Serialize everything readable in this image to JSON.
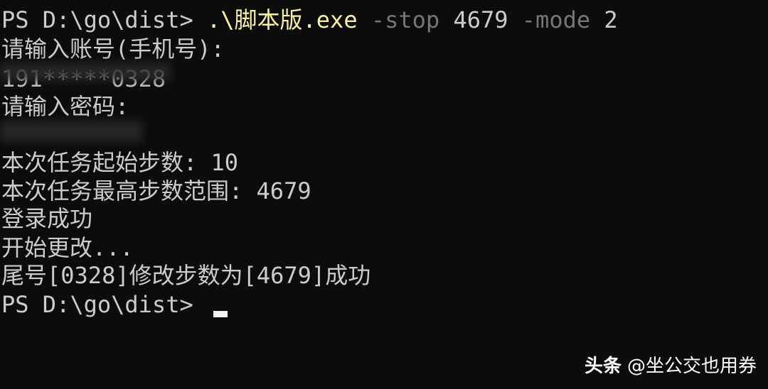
{
  "terminal": {
    "command_line": {
      "prompt": "PS D:\\go\\dist> ",
      "executable": ".\\脚本版.exe",
      "flag_stop": "-stop",
      "value_stop": "4679",
      "flag_mode": "-mode",
      "value_mode": "2"
    },
    "lines": {
      "account_prompt": "请输入账号(手机号):",
      "account_value": "191*****0328",
      "password_prompt": "请输入密码:",
      "start_steps": "本次任务起始步数: 10",
      "max_steps_range": "本次任务最高步数范围: 4679",
      "login_success": "登录成功",
      "start_change": "开始更改...",
      "result": "尾号[0328]修改步数为[4679]成功",
      "final_prompt": "PS D:\\go\\dist> "
    }
  },
  "watermark": {
    "brand": "头条",
    "handle": "@坐公交也用券"
  },
  "colors": {
    "background": "#0c0c0c",
    "text": "#cccccc",
    "command": "#f9f1a5",
    "parameter": "#767676"
  }
}
